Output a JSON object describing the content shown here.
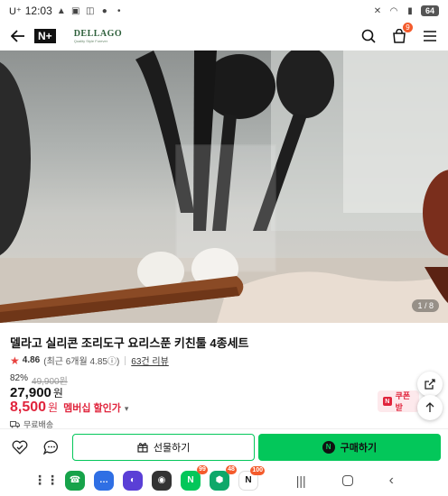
{
  "status_bar": {
    "carrier": "U⁺",
    "time": "12:03",
    "battery": "64"
  },
  "header": {
    "logo": "N+",
    "brand_name": "DELLAGO",
    "brand_tagline": "Quality Style Forever",
    "cart_count": "9"
  },
  "gallery": {
    "pager": "1 / 8"
  },
  "product": {
    "title": "델라고 실리콘 조리도구 요리스푼 키친툴 4종세트",
    "rating": "4.86",
    "recent_rating": "(최근 6개월 4.85ⓘ)",
    "reviews": "63건 리뷰",
    "discount_pct": "82%",
    "original_price": "49,900원",
    "price": "27,900",
    "price_unit": "원",
    "member_price": "8,500",
    "member_unit": "원",
    "member_label": "멤버십 할인가",
    "shipping": "무료배송",
    "coupon_label": "쿠폰 받"
  },
  "actions": {
    "gift": "선물하기",
    "buy": "구매하기"
  },
  "dock": {
    "badges": [
      "99",
      "48",
      "100"
    ]
  },
  "colors": {
    "accent_green": "#03c75a",
    "price_red": "#e0243c",
    "badge_orange": "#f45b2c"
  }
}
